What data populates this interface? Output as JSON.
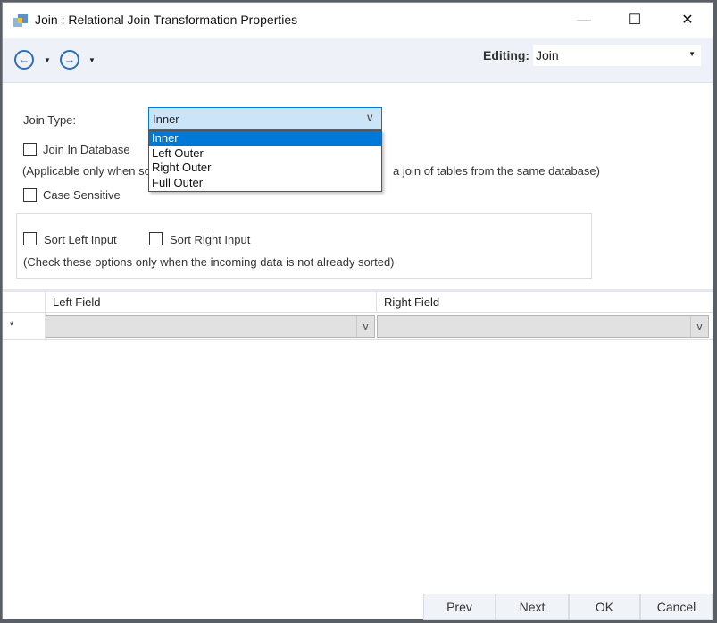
{
  "window": {
    "title": "Join : Relational Join Transformation Properties",
    "minimize": "—",
    "maximize": "☐",
    "close": "✕"
  },
  "toolbar": {
    "back_icon": "arrow-left-circle",
    "forward_icon": "arrow-right-circle",
    "editing_label": "Editing:",
    "editing_value": "Join"
  },
  "form": {
    "join_type_label": "Join Type:",
    "join_type_value": "Inner",
    "join_type_options": [
      "Inner",
      "Left Outer",
      "Right Outer",
      "Full Outer"
    ],
    "join_in_database_label": "Join In Database",
    "join_in_database_note_left": "(Applicable only when so",
    "join_in_database_note_right": "a join of tables from the same database)",
    "case_sensitive_label": "Case Sensitive",
    "sort_left_label": "Sort Left Input",
    "sort_right_label": "Sort Right Input",
    "sort_note": "(Check these options only when the incoming data is not already sorted)"
  },
  "grid": {
    "columns": [
      "Left Field",
      "Right Field"
    ],
    "new_row_marker": "*"
  },
  "buttons": {
    "prev": "Prev",
    "next": "Next",
    "ok": "OK",
    "cancel": "Cancel"
  }
}
